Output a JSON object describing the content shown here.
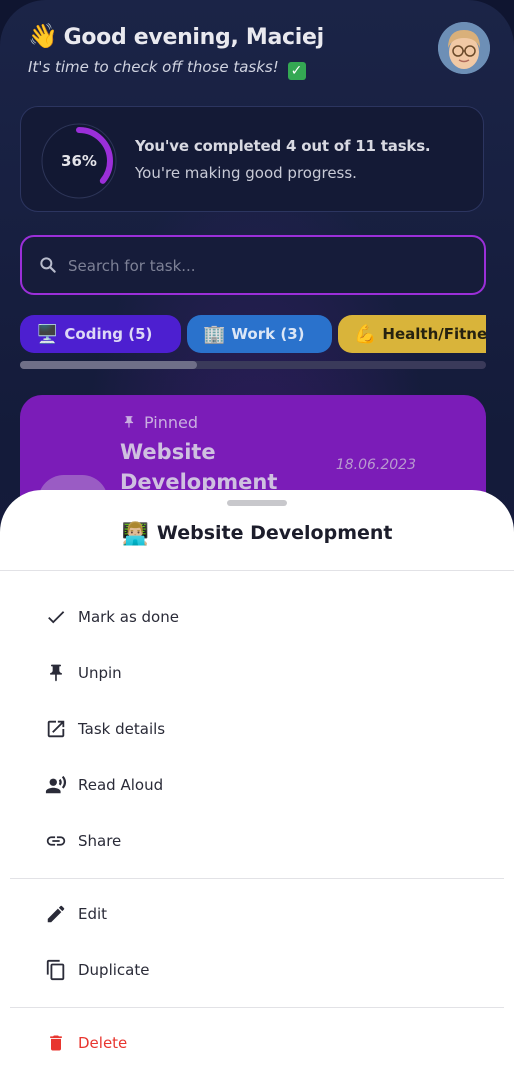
{
  "header": {
    "greeting": "Good evening, Maciej",
    "wave_emoji": "👋",
    "subtitle": "It's time to check off those tasks!",
    "check_emoji": "✓"
  },
  "progress": {
    "percent_label": "36%",
    "percent": 36,
    "title": "You've completed 4 out of 11 tasks.",
    "subtitle": "You're making good progress.",
    "accent_color": "#9b2fd9"
  },
  "search": {
    "placeholder": "Search for task..."
  },
  "categories": [
    {
      "emoji": "🖥️",
      "label": "Coding (5)",
      "color": "#4d1fd0"
    },
    {
      "emoji": "🏢",
      "label": "Work (3)",
      "color": "#2a72cc"
    },
    {
      "emoji": "💪",
      "label": "Health/Fitness",
      "color": "#d9b43a"
    }
  ],
  "task_card": {
    "pinned_label": "Pinned",
    "name": "Website Development",
    "date": "18.06.2023",
    "color": "#7b1cb8"
  },
  "sheet": {
    "emoji": "👨🏼‍💻",
    "title": "Website Development",
    "items": [
      {
        "icon": "check-icon",
        "label": "Mark as done"
      },
      {
        "icon": "pin-icon",
        "label": "Unpin"
      },
      {
        "icon": "open-in-new-icon",
        "label": "Task details"
      },
      {
        "icon": "record-voice-icon",
        "label": "Read Aloud"
      },
      {
        "icon": "link-icon",
        "label": "Share"
      },
      {
        "icon": "edit-icon",
        "label": "Edit"
      },
      {
        "icon": "copy-icon",
        "label": "Duplicate"
      },
      {
        "icon": "delete-icon",
        "label": "Delete",
        "color": "#e8362f"
      }
    ]
  }
}
